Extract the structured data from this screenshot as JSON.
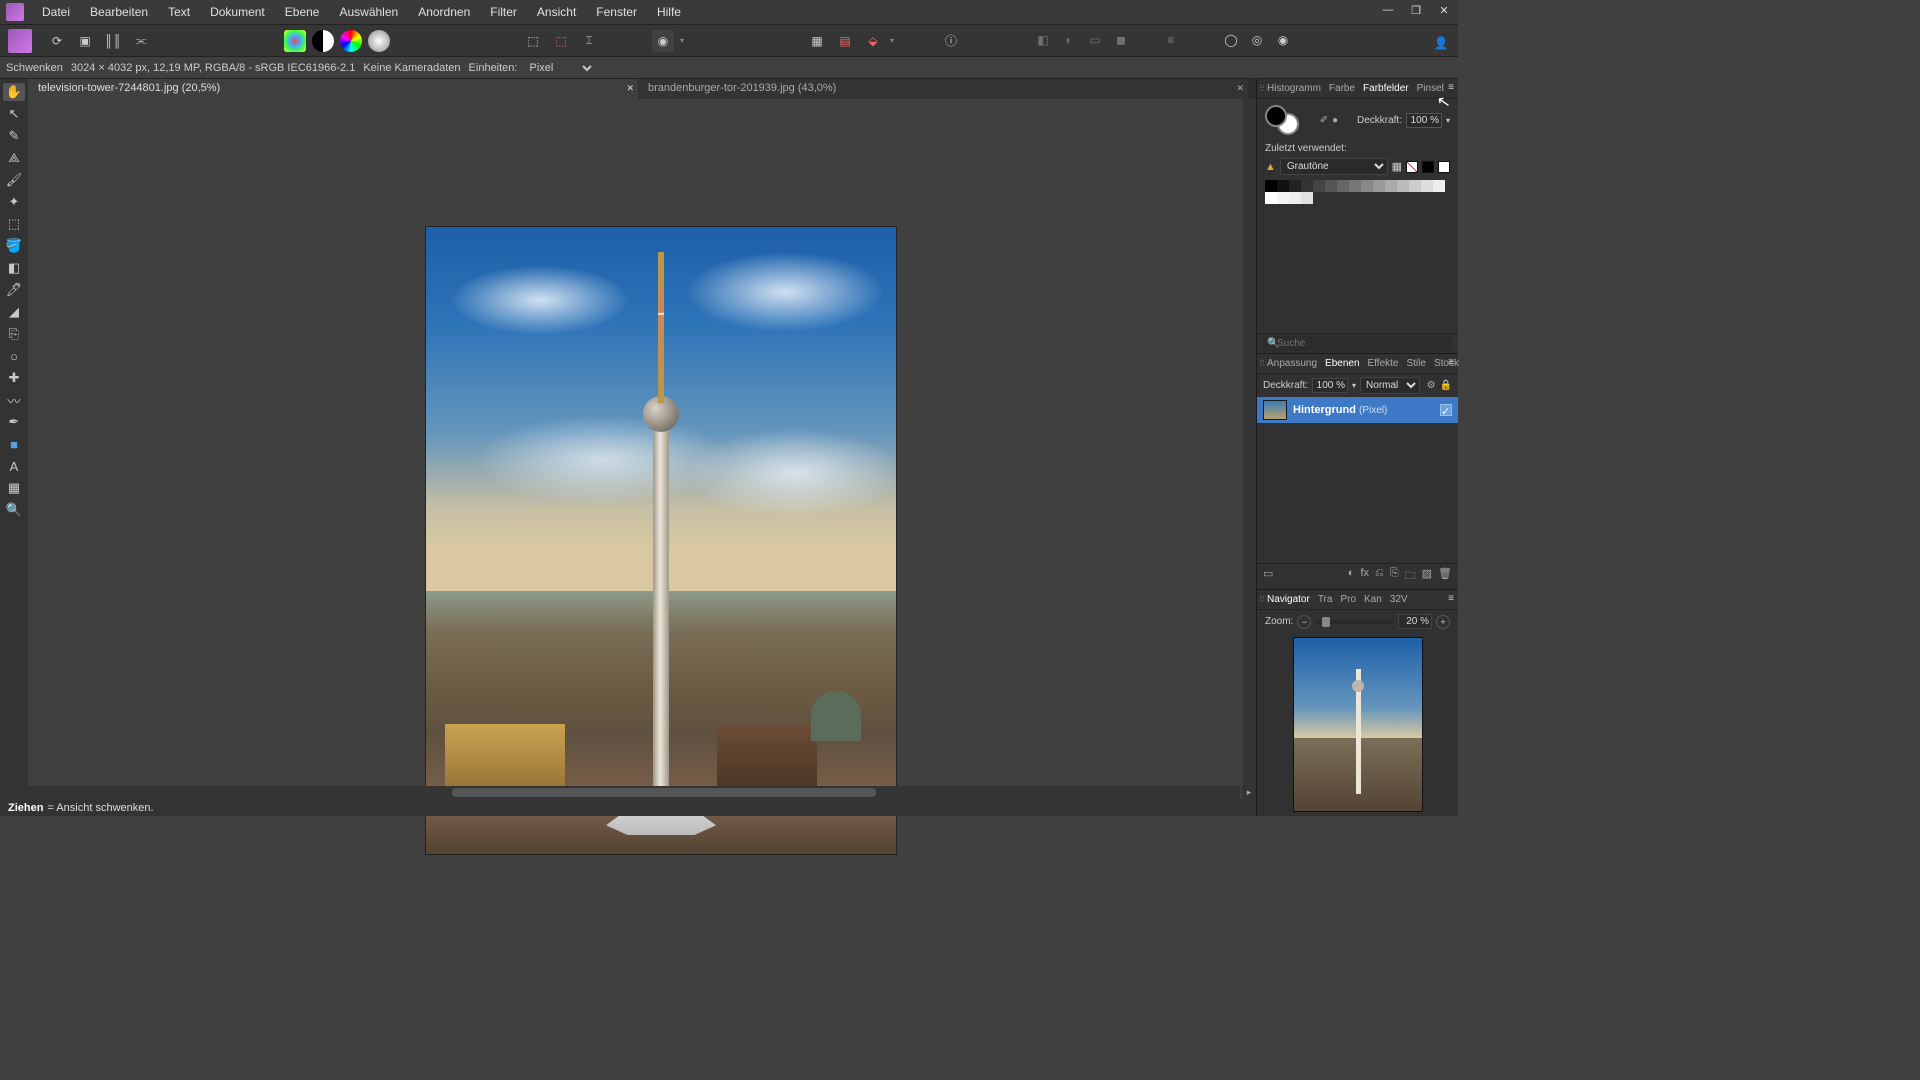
{
  "menu": {
    "items": [
      "Datei",
      "Bearbeiten",
      "Text",
      "Dokument",
      "Ebene",
      "Auswählen",
      "Anordnen",
      "Filter",
      "Ansicht",
      "Fenster",
      "Hilfe"
    ]
  },
  "window": {
    "min": "—",
    "max": "❐",
    "close": "✕"
  },
  "context": {
    "tool": "Schwenken",
    "docinfo": "3024 × 4032 px, 12,19 MP, RGBA/8 - sRGB IEC61966-2.1",
    "camera": "Keine Kameradaten",
    "units_label": "Einheiten:",
    "units_value": "Pixel"
  },
  "tabs": [
    {
      "label": "television-tower-7244801.jpg (20,5%)",
      "active": true
    },
    {
      "label": "brandenburger-tor-201939.jpg (43,0%)",
      "active": false
    }
  ],
  "color_panel": {
    "tabs": [
      "Histogramm",
      "Farbe",
      "Farbfelder",
      "Pinsel"
    ],
    "active": "Farbfelder",
    "opacity_label": "Deckkraft:",
    "opacity_value": "100 %",
    "recent_label": "Zuletzt verwendet:",
    "palette": "Grautöne",
    "search_placeholder": "Suche"
  },
  "layers_panel": {
    "tabs": [
      "Anpassung",
      "Ebenen",
      "Effekte",
      "Stile",
      "Stock"
    ],
    "active": "Ebenen",
    "opacity_label": "Deckkraft:",
    "opacity_value": "100 %",
    "blend": "Normal",
    "layer_name": "Hintergrund",
    "layer_type": "(Pixel)"
  },
  "navigator": {
    "tabs": [
      "Navigator",
      "Tra",
      "Pro",
      "Kan",
      "32V"
    ],
    "active": "Navigator",
    "zoom_label": "Zoom:",
    "zoom_value": "20 %"
  },
  "status": {
    "drag": "Ziehen",
    "hint": "= Ansicht schwenken."
  },
  "grays": [
    "#000000",
    "#111111",
    "#222222",
    "#333333",
    "#444444",
    "#555555",
    "#666666",
    "#777777",
    "#888888",
    "#999999",
    "#aaaaaa",
    "#bbbbbb",
    "#cccccc",
    "#dddddd",
    "#eeeeee",
    "#ffffff",
    "#f5f5f5",
    "#ededed",
    "#e0e0e0"
  ]
}
